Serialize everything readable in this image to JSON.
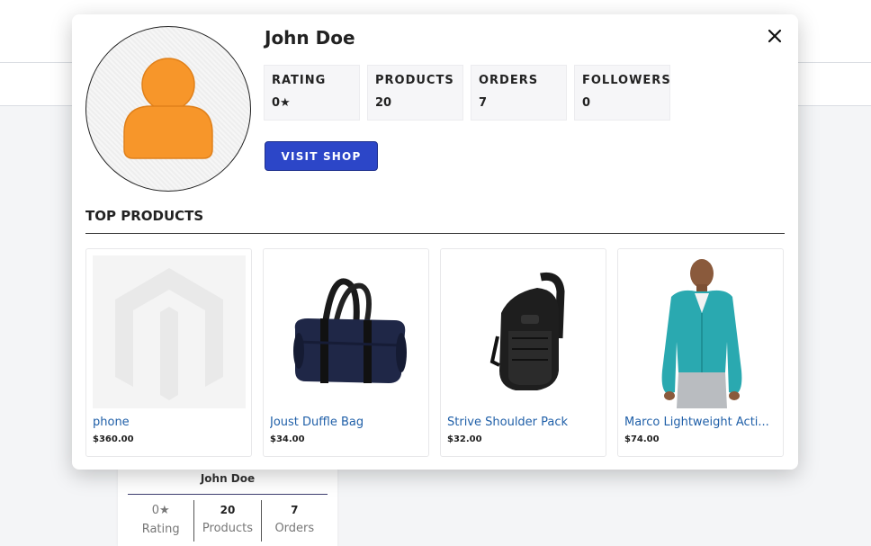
{
  "background": {
    "card": {
      "name": "John Doe",
      "stats": [
        {
          "value": "0★",
          "label": "Rating"
        },
        {
          "value": "20",
          "label": "Products"
        },
        {
          "value": "7",
          "label": "Orders"
        }
      ]
    }
  },
  "modal": {
    "seller_name": "John Doe",
    "stats": [
      {
        "label": "RATING",
        "value": "0★"
      },
      {
        "label": "PRODUCTS",
        "value": "20"
      },
      {
        "label": "ORDERS",
        "value": "7"
      },
      {
        "label": "FOLLOWERS",
        "value": "0"
      }
    ],
    "visit_shop_label": "VISIT SHOP",
    "section_title": "TOP PRODUCTS",
    "products": [
      {
        "name": "phone",
        "price": "$360.00",
        "image": "magento-placeholder"
      },
      {
        "name": "Joust Duffle Bag",
        "price": "$34.00",
        "image": "duffle-bag"
      },
      {
        "name": "Strive Shoulder Pack",
        "price": "$32.00",
        "image": "shoulder-pack"
      },
      {
        "name": "Marco Lightweight Acti...",
        "price": "$74.00",
        "image": "teal-hoodie"
      }
    ]
  },
  "colors": {
    "accent": "#2c46c8",
    "avatar": "#f7962a",
    "link": "#1f5fa8"
  }
}
